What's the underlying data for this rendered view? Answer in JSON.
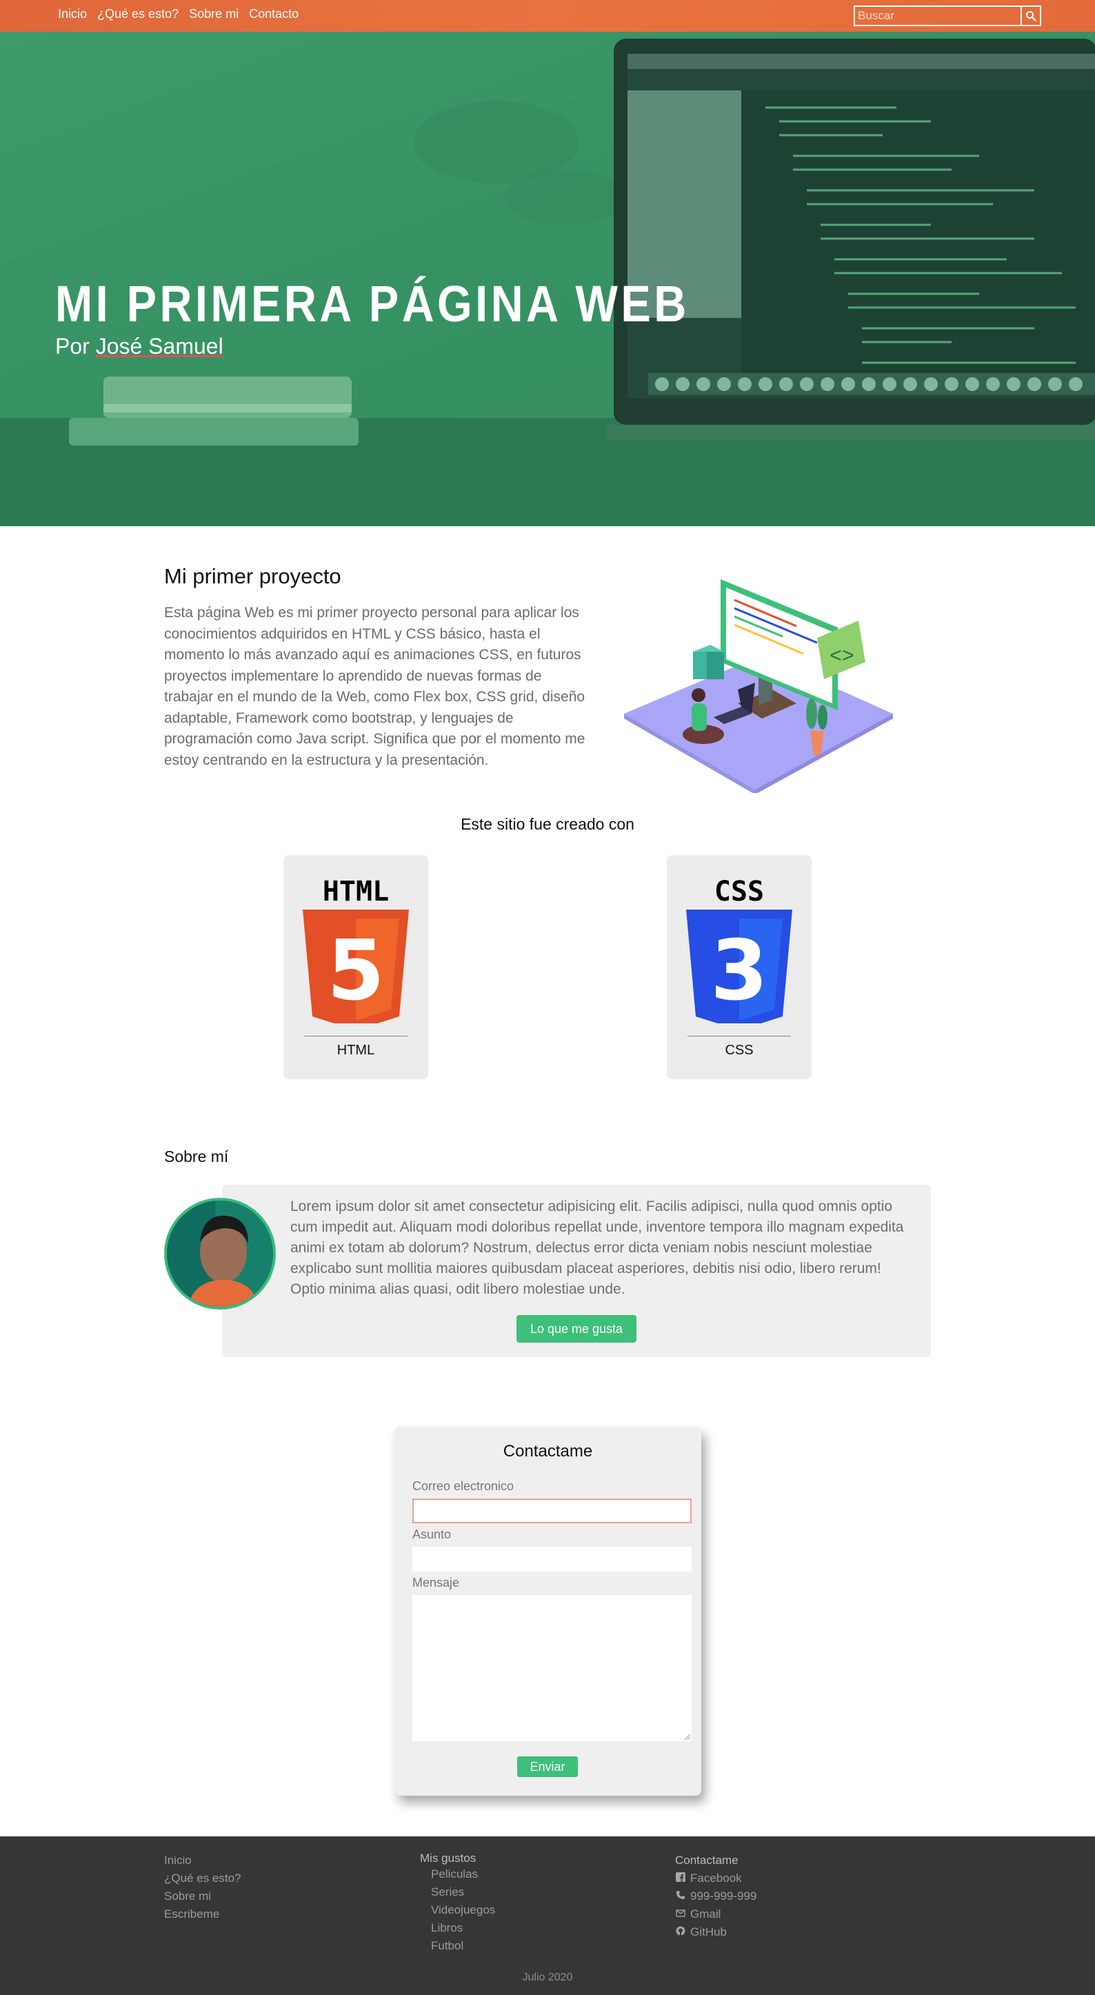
{
  "nav": {
    "links": [
      "Inicio",
      "¿Qué es esto?",
      "Sobre mi",
      "Contacto"
    ],
    "search_placeholder": "Buscar"
  },
  "hero": {
    "title": "MI PRIMERA PÁGINA WEB",
    "subtitle_prefix": "Por ",
    "author": "José Samuel"
  },
  "project": {
    "title": "Mi primer proyecto",
    "text": "Esta página Web es mi primer proyecto personal para aplicar los conocimientos adquiridos en HTML y CSS básico, hasta el momento lo más avanzado aquí es animaciones CSS, en futuros proyectos implementare lo aprendido de nuevas formas de trabajar en el mundo de la Web, como Flex box, CSS grid, diseño adaptable, Framework como bootstrap, y lenguajes de programación como Java script. Significa que por el momento me estoy centrando en la estructura y la presentación."
  },
  "tech": {
    "heading": "Este sitio fue creado con",
    "cards": [
      {
        "logo_text": "HTML",
        "number": "5",
        "label": "HTML",
        "color": "#e34f26"
      },
      {
        "logo_text": "CSS",
        "number": "3",
        "label": "CSS",
        "color": "#264de4"
      }
    ]
  },
  "about": {
    "title": "Sobre mí",
    "text": "Lorem ipsum dolor sit amet consectetur adipisicing elit. Facilis adipisci, nulla quod omnis optio cum impedit aut. Aliquam modi doloribus repellat unde, inventore tempora illo magnam expedita animi ex totam ab dolorum? Nostrum, delectus error dicta veniam nobis nesciunt molestiae explicabo sunt mollitia maiores quibusdam placeat asperiores, debitis nisi odio, libero rerum! Optio minima alias quasi, odit libero molestiae unde.",
    "button": "Lo que me gusta"
  },
  "contact": {
    "title": "Contactame",
    "email_label": "Correo electronico",
    "subject_label": "Asunto",
    "message_label": "Mensaje",
    "send": "Enviar"
  },
  "footer": {
    "nav": [
      "Inicio",
      "¿Qué es esto?",
      "Sobre mi",
      "Escribeme"
    ],
    "likes_title": "Mis gustos",
    "likes": [
      "Peliculas",
      "Series",
      "Videojuegos",
      "Libros",
      "Futbol"
    ],
    "contact_title": "Contactame",
    "contact": [
      {
        "icon": "facebook-icon",
        "text": "Facebook"
      },
      {
        "icon": "phone-icon",
        "text": "999-999-999"
      },
      {
        "icon": "mail-icon",
        "text": "Gmail"
      },
      {
        "icon": "github-icon",
        "text": "GitHub"
      }
    ],
    "date": "Julio 2020"
  },
  "colors": {
    "accent": "#3cc07a",
    "nav": "#e8733f",
    "hero": "#2f8b5c",
    "footer": "#363636"
  }
}
